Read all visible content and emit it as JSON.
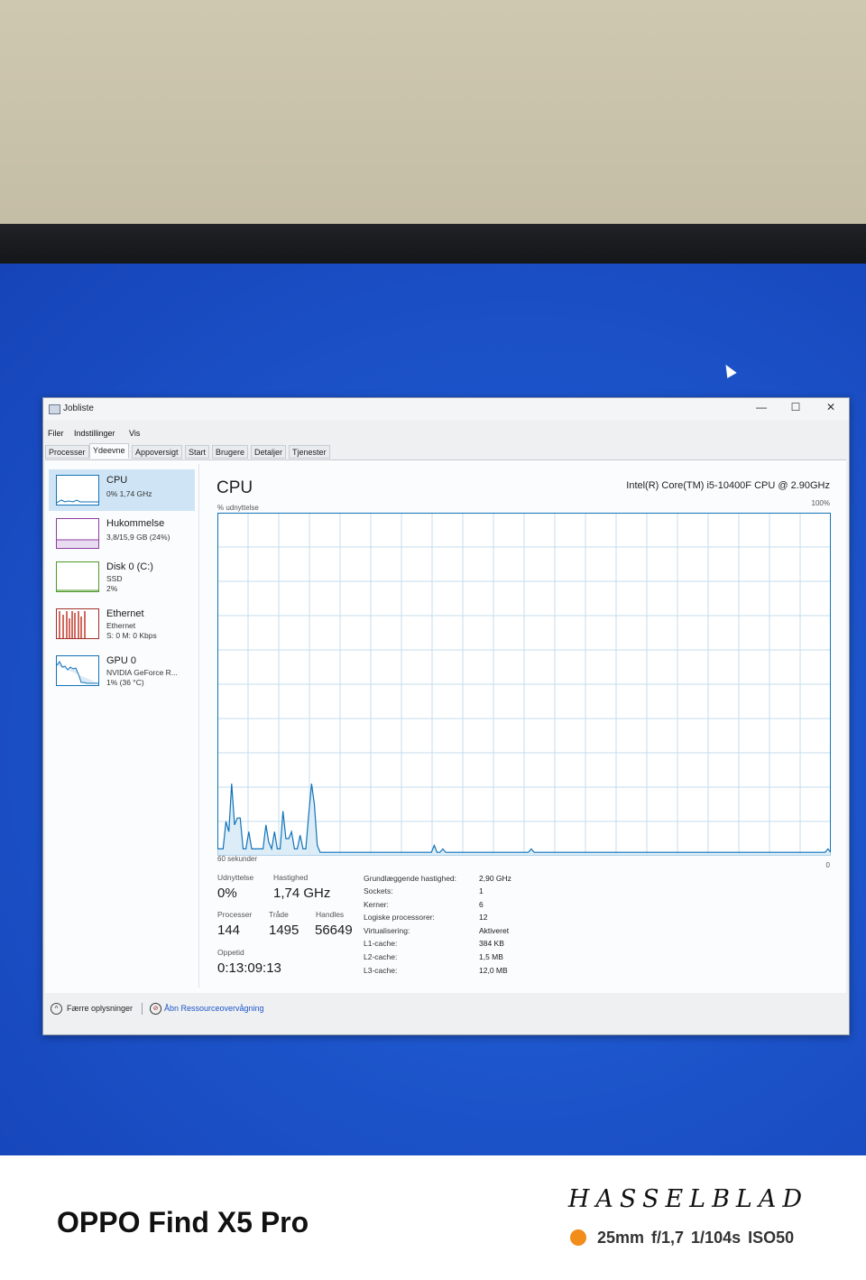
{
  "window": {
    "title": "Jobliste",
    "controls": {
      "minimize": "—",
      "maximize": "☐",
      "close": "✕"
    }
  },
  "menu": [
    "Filer",
    "Indstillinger",
    "Vis"
  ],
  "tabs": [
    "Processer",
    "Ydeevne",
    "Appoversigt",
    "Start",
    "Brugere",
    "Detaljer",
    "Tjenester"
  ],
  "active_tab": "Ydeevne",
  "sidebar": [
    {
      "title": "CPU",
      "line1": "0% 1,74 GHz",
      "line2": "",
      "color": "#1173b8"
    },
    {
      "title": "Hukommelse",
      "line1": "3,8/15,9 GB (24%)",
      "line2": "",
      "color": "#8b3fa0"
    },
    {
      "title": "Disk 0 (C:)",
      "line1": "SSD",
      "line2": "2%",
      "color": "#4e9a2a"
    },
    {
      "title": "Ethernet",
      "line1": "Ethernet",
      "line2": "S: 0 M: 0 Kbps",
      "color": "#a0302a"
    },
    {
      "title": "GPU 0",
      "line1": "NVIDIA GeForce R...",
      "line2": "1% (36 °C)",
      "color": "#1173b8"
    }
  ],
  "main": {
    "title": "CPU",
    "cpu_model": "Intel(R) Core(TM) i5-10400F CPU @ 2.90GHz",
    "util_label": "% udnyttelse",
    "max_label": "100%",
    "time_label": "60 sekunder",
    "min_label": "0"
  },
  "chart_data": {
    "type": "area",
    "xlabel": "60 sekunder",
    "ylabel": "% udnyttelse",
    "ylim": [
      0,
      100
    ],
    "x_range_seconds": [
      60,
      0
    ],
    "values": [
      2,
      2,
      2,
      10,
      7,
      21,
      9,
      11,
      11,
      2,
      2,
      7,
      2,
      2,
      2,
      2,
      2,
      9,
      4,
      2,
      7,
      2,
      2,
      13,
      5,
      5,
      7,
      2,
      2,
      6,
      2,
      2,
      12,
      21,
      15,
      3,
      1,
      1,
      1,
      1,
      1,
      1,
      1,
      1,
      1,
      1,
      1,
      1,
      1,
      1,
      1,
      1,
      1,
      1,
      1,
      1,
      1,
      1,
      1,
      1,
      1,
      1,
      1,
      1,
      1,
      1,
      1,
      1,
      1,
      1,
      1,
      1,
      1,
      1,
      1,
      1,
      3,
      1,
      1,
      2,
      1,
      1,
      1,
      1,
      1,
      1,
      1,
      1,
      1,
      1,
      1,
      1,
      1,
      1,
      1,
      1,
      1,
      1,
      1,
      1,
      1,
      1,
      1,
      1,
      1,
      1,
      1,
      1,
      1,
      1,
      2,
      1,
      1,
      1,
      1,
      1,
      1,
      1,
      1,
      1,
      1,
      1,
      1,
      1,
      1,
      1,
      1,
      1,
      1,
      1,
      1,
      1,
      1,
      1,
      1,
      1,
      1,
      1,
      1,
      1,
      1,
      1,
      1,
      1,
      1,
      1,
      1,
      1,
      1,
      1,
      1,
      1,
      1,
      1,
      1,
      1,
      1,
      1,
      1,
      1,
      1,
      1,
      1,
      1,
      1,
      1,
      1,
      1,
      1,
      1,
      1,
      1,
      1,
      1,
      1,
      1,
      1,
      1,
      1,
      1,
      1,
      1,
      1,
      1,
      1,
      1,
      1,
      1,
      1,
      1,
      1,
      1,
      1,
      1,
      1,
      1,
      1,
      1,
      1,
      1,
      1,
      1,
      1,
      1,
      1,
      1,
      1,
      1,
      1,
      1,
      1,
      1,
      1,
      1,
      2,
      1
    ],
    "grid": true,
    "line_color": "#1173b8",
    "fill_color": "#d5e8f6",
    "grid_color": "#c6dcee"
  },
  "stats": {
    "udnyttelse": {
      "label": "Udnyttelse",
      "value": "0%"
    },
    "hastighed": {
      "label": "Hastighed",
      "value": "1,74 GHz"
    },
    "processer": {
      "label": "Processer",
      "value": "144"
    },
    "traade": {
      "label": "Tråde",
      "value": "1495"
    },
    "handles": {
      "label": "Handles",
      "value": "56649"
    },
    "oppetid": {
      "label": "Oppetid",
      "value": "0:13:09:13"
    }
  },
  "specs": [
    {
      "label": "Grundlæggende hastighed:",
      "value": "2,90 GHz"
    },
    {
      "label": "Sockets:",
      "value": "1"
    },
    {
      "label": "Kerner:",
      "value": "6"
    },
    {
      "label": "Logiske processorer:",
      "value": "12"
    },
    {
      "label": "Virtualisering:",
      "value": "Aktiveret"
    },
    {
      "label": "L1-cache:",
      "value": "384 KB"
    },
    {
      "label": "L2-cache:",
      "value": "1,5 MB"
    },
    {
      "label": "L3-cache:",
      "value": "12,0 MB"
    }
  ],
  "footer": {
    "fewer_details": "Færre oplysninger",
    "resource_monitor": "Åbn Ressourceovervågning"
  },
  "camera": {
    "model": "OPPO Find X5 Pro",
    "brand": "HASSELBLAD",
    "exif": "25mm  f/1,7  1/104s  ISO50",
    "dot_color": "#f28c1a"
  }
}
